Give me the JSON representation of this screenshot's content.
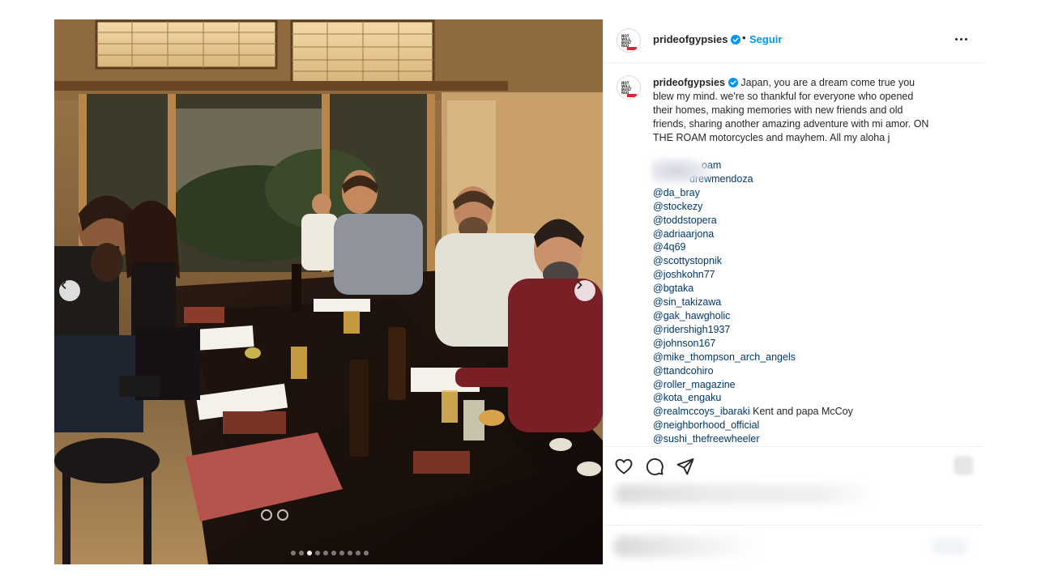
{
  "post": {
    "username": "prideofgypsies",
    "follow_label": "Seguir",
    "follow_separator": "•",
    "verified": true,
    "avatar_text": "NOT WILL NOT BE BUILT ON DOUBLE RED",
    "carousel": {
      "active_index": 2,
      "total": 10
    },
    "caption_text": "Japan, you are a dream come true you blew my mind. we're so thankful for everyone who opened their homes, making memories with new friends and old friends, sharing another amazing adventure with mi amor. ON THE ROAM motorcycles and mayhem. All my aloha j",
    "mentions": [
      {
        "handle": "oam",
        "suffix": ""
      },
      {
        "handle": "drewmendoza",
        "suffix": ""
      },
      {
        "handle": "@da_bray",
        "suffix": ""
      },
      {
        "handle": "@stockezy",
        "suffix": ""
      },
      {
        "handle": "@toddstopera",
        "suffix": ""
      },
      {
        "handle": "@adriaarjona",
        "suffix": ""
      },
      {
        "handle": "@4q69",
        "suffix": ""
      },
      {
        "handle": "@scottystopnik",
        "suffix": ""
      },
      {
        "handle": "@joshkohn77",
        "suffix": ""
      },
      {
        "handle": "@bgtaka",
        "suffix": ""
      },
      {
        "handle": "@sin_takizawa",
        "suffix": ""
      },
      {
        "handle": "@gak_hawgholic",
        "suffix": ""
      },
      {
        "handle": "@ridershigh1937",
        "suffix": ""
      },
      {
        "handle": "@johnson167",
        "suffix": ""
      },
      {
        "handle": "@mike_thompson_arch_angels",
        "suffix": ""
      },
      {
        "handle": "@ttandcohiro",
        "suffix": ""
      },
      {
        "handle": "@roller_magazine",
        "suffix": ""
      },
      {
        "handle": "@kota_engaku",
        "suffix": ""
      },
      {
        "handle": "@realmccoys_ibaraki",
        "suffix": " Kent and papa McCoy"
      },
      {
        "handle": "@neighborhood_official",
        "suffix": ""
      },
      {
        "handle": "@sushi_thefreewheeler",
        "suffix": ""
      }
    ],
    "icons": {
      "like": "heart-icon",
      "comment": "comment-bubble-icon",
      "share": "send-paper-plane-icon",
      "more": "more-horizontal-icon",
      "verified": "verified-badge-icon",
      "prev": "chevron-left-icon",
      "next": "chevron-right-icon"
    },
    "colors": {
      "link_blue": "#0095f6",
      "mention_blue": "#00376b",
      "text": "#262626",
      "divider": "#efefef"
    }
  }
}
